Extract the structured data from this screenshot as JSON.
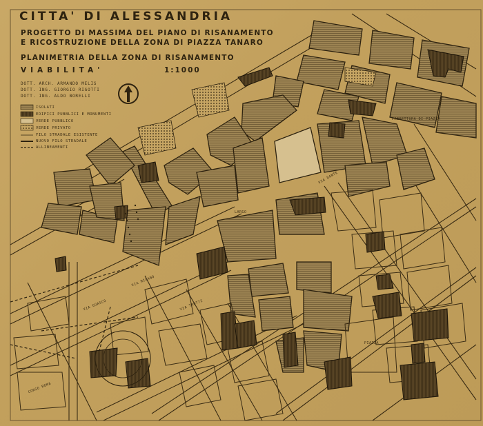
{
  "title": {
    "city": "CITTA' DI ALESSANDRIA",
    "project_line1": "PROGETTO DI MASSIMA DEL PIANO DI RISANAMENTO",
    "project_line2": "E RICOSTRUZIONE DELLA ZONA DI PIAZZA TANARO",
    "plan": "PLANIMETRIA DELLA ZONA DI RISANAMENTO",
    "subject": "VIABILITA'",
    "scale": "1:1000"
  },
  "authors": [
    "DOTT. ARCH. ARMANDO MELIS",
    "DOTT. ING. GIORGIO RIGOTTI",
    "DOTT. ING. ALDO BORELLI"
  ],
  "legend": [
    {
      "label": "ISOLATI",
      "pattern": "hatch"
    },
    {
      "label": "EDIFICI PUBBLICI E MONUMENTI",
      "pattern": "dense"
    },
    {
      "label": "VERDE PUBBLICO",
      "pattern": "light"
    },
    {
      "label": "VERDE PRIVATO",
      "pattern": "dots"
    },
    {
      "label": "FILO STRADALE ESISTENTE",
      "pattern": "thin-line"
    },
    {
      "label": "NUOVO FILO STRADALE",
      "pattern": "thick-line"
    },
    {
      "label": "ALLINEAMENTI",
      "pattern": "dashed-line"
    }
  ],
  "map_labels": {
    "piazza": "PIAZZA",
    "prefettura": "PREFETTURA DI PIAZZA",
    "via_milano": "VIA MILANO",
    "via_trotti": "VIA TROTTI",
    "largo": "LARGO",
    "corso": "CORSO ROMA",
    "via_dante": "VIA DANTE",
    "via_guasco": "VIA GUASCO"
  },
  "colors": {
    "paper": "#bd9b58",
    "ink": "#2e2310",
    "block_fill": "#8a7246",
    "public_fill": "#5e4a28"
  },
  "icons": [
    "north-arrow-icon"
  ]
}
